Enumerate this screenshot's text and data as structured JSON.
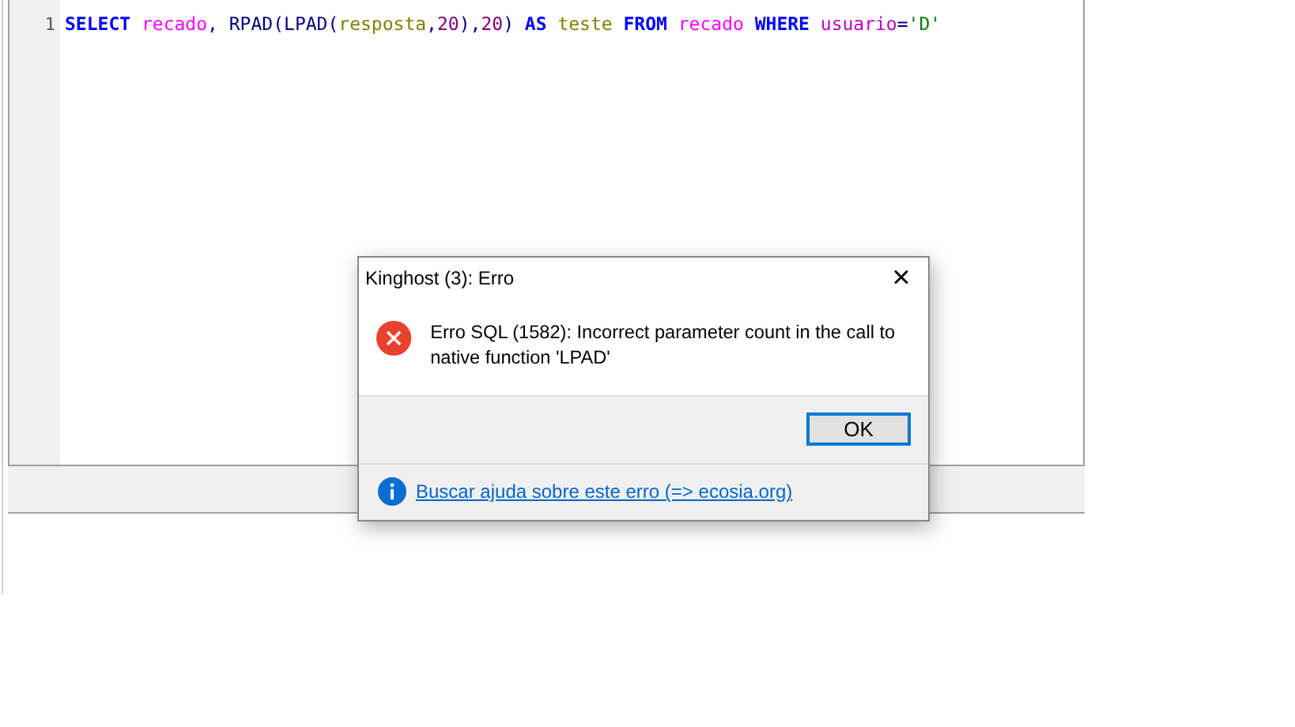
{
  "editor": {
    "line_number": "1",
    "tokens": [
      {
        "text": "SELECT ",
        "kind": "keyword"
      },
      {
        "text": "recado",
        "kind": "table"
      },
      {
        "text": ", ",
        "kind": "plain"
      },
      {
        "text": "RPAD",
        "kind": "function"
      },
      {
        "text": "(",
        "kind": "plain"
      },
      {
        "text": "LPAD",
        "kind": "function"
      },
      {
        "text": "(",
        "kind": "plain"
      },
      {
        "text": "resposta",
        "kind": "column"
      },
      {
        "text": ",",
        "kind": "plain"
      },
      {
        "text": "20",
        "kind": "number"
      },
      {
        "text": "),",
        "kind": "plain"
      },
      {
        "text": "20",
        "kind": "number"
      },
      {
        "text": ") ",
        "kind": "plain"
      },
      {
        "text": "AS ",
        "kind": "keyword"
      },
      {
        "text": "teste ",
        "kind": "column"
      },
      {
        "text": "FROM ",
        "kind": "keyword"
      },
      {
        "text": "recado ",
        "kind": "table"
      },
      {
        "text": "WHERE ",
        "kind": "keyword"
      },
      {
        "text": "usuario",
        "kind": "field"
      },
      {
        "text": "=",
        "kind": "plain"
      },
      {
        "text": "'D'",
        "kind": "string"
      }
    ]
  },
  "dialog": {
    "title": "Kinghost (3): Erro",
    "close": "×",
    "message": "Erro SQL (1582): Incorrect parameter count in the call to native function 'LPAD'",
    "button": "OK",
    "help_link": "Buscar ajuda sobre este erro (=> ecosia.org)"
  }
}
